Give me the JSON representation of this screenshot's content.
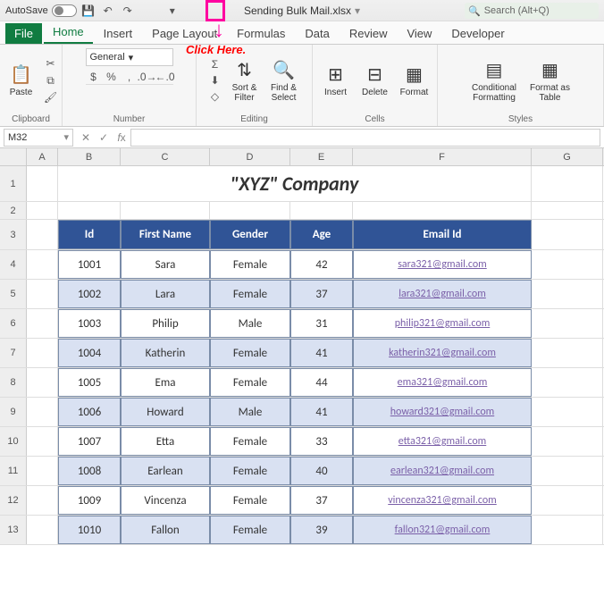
{
  "titlebar": {
    "autosave": "AutoSave",
    "toggle": "Off",
    "filename": "Sending Bulk Mail.xlsx",
    "search_placeholder": "Search (Alt+Q)"
  },
  "annotation": {
    "caption": "Click Here."
  },
  "tabs": [
    "File",
    "Home",
    "Insert",
    "Page Layout",
    "Formulas",
    "Data",
    "Review",
    "View",
    "Developer"
  ],
  "active_tab": "Home",
  "ribbon": {
    "clipboard": {
      "paste": "Paste",
      "label": "Clipboard"
    },
    "number": {
      "format": "General",
      "label": "Number"
    },
    "editing": {
      "sort": "Sort &\nFilter",
      "find": "Find &\nSelect",
      "label": "Editing"
    },
    "cells": {
      "insert": "Insert",
      "delete": "Delete",
      "format": "Format",
      "label": "Cells"
    },
    "styles": {
      "cond": "Conditional\nFormatting",
      "table": "Format as\nTable",
      "label": "Styles"
    }
  },
  "namebox": "M32",
  "columns": [
    "A",
    "B",
    "C",
    "D",
    "E",
    "F",
    "G"
  ],
  "title": "\"XYZ\" Company",
  "headers": {
    "id": "Id",
    "first": "First Name",
    "gender": "Gender",
    "age": "Age",
    "email": "Email Id"
  },
  "rows": [
    {
      "n": 4,
      "id": "1001",
      "first": "Sara",
      "gender": "Female",
      "age": "42",
      "email": "sara321@gmail.com",
      "alt": false
    },
    {
      "n": 5,
      "id": "1002",
      "first": "Lara",
      "gender": "Female",
      "age": "37",
      "email": "lara321@gmail.com",
      "alt": true
    },
    {
      "n": 6,
      "id": "1003",
      "first": "Philip",
      "gender": "Male",
      "age": "31",
      "email": "philip321@gmail.com",
      "alt": false
    },
    {
      "n": 7,
      "id": "1004",
      "first": "Katherin",
      "gender": "Female",
      "age": "41",
      "email": "katherin321@gmail.com",
      "alt": true
    },
    {
      "n": 8,
      "id": "1005",
      "first": "Ema",
      "gender": "Female",
      "age": "44",
      "email": "ema321@gmail.com",
      "alt": false
    },
    {
      "n": 9,
      "id": "1006",
      "first": "Howard",
      "gender": "Male",
      "age": "41",
      "email": "howard321@gmail.com",
      "alt": true
    },
    {
      "n": 10,
      "id": "1007",
      "first": "Etta",
      "gender": "Female",
      "age": "33",
      "email": "etta321@gmail.com",
      "alt": false
    },
    {
      "n": 11,
      "id": "1008",
      "first": "Earlean",
      "gender": "Female",
      "age": "40",
      "email": "earlean321@gmail.com",
      "alt": true
    },
    {
      "n": 12,
      "id": "1009",
      "first": "Vincenza",
      "gender": "Female",
      "age": "37",
      "email": "vincenza321@gmail.com",
      "alt": false
    },
    {
      "n": 13,
      "id": "1010",
      "first": "Fallon",
      "gender": "Female",
      "age": "39",
      "email": "fallon321@gmail.com",
      "alt": true
    }
  ]
}
